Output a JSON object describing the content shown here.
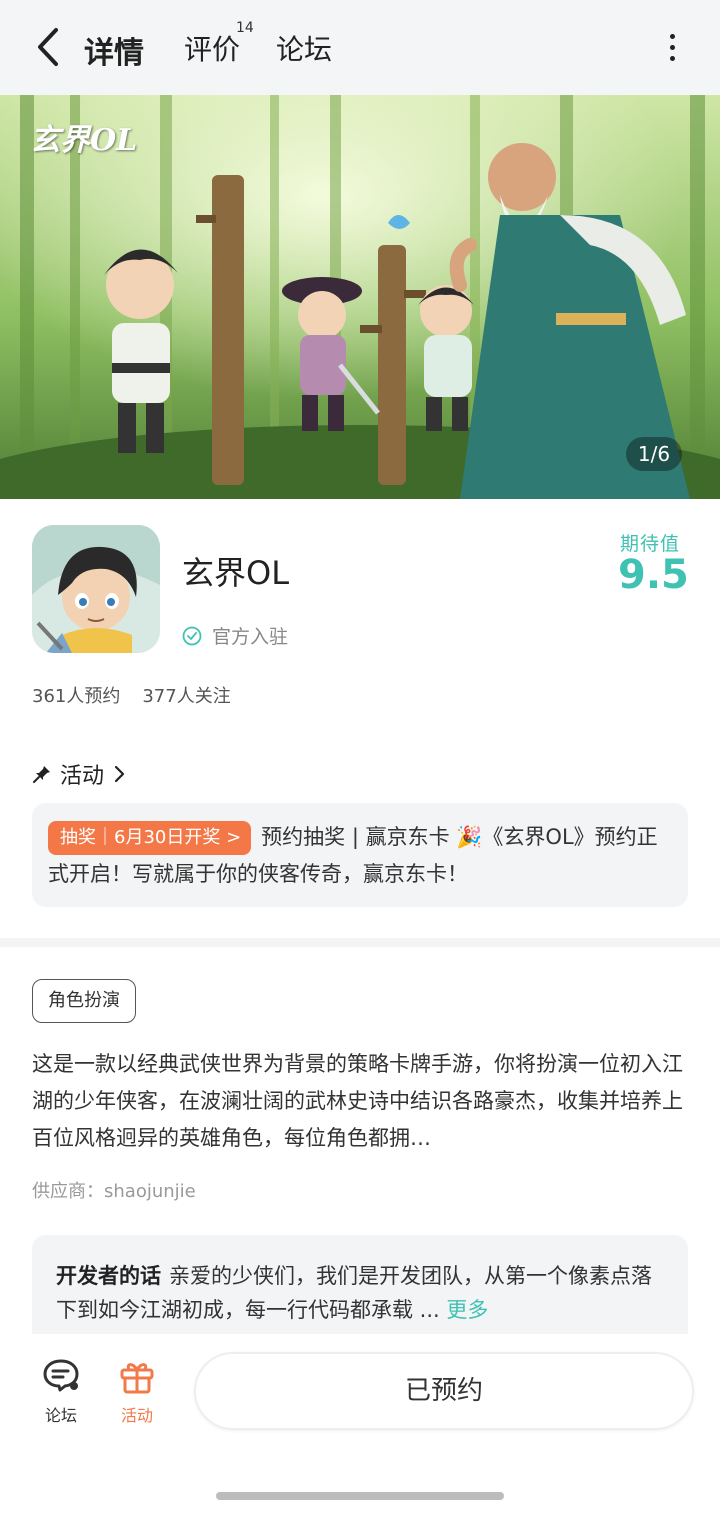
{
  "header": {
    "tabs": [
      {
        "label": "详情",
        "active": true
      },
      {
        "label": "评价",
        "badge": "14"
      },
      {
        "label": "论坛"
      }
    ]
  },
  "banner": {
    "logo_text": "玄界OL",
    "counter": "1/6"
  },
  "game": {
    "name": "玄界OL",
    "official_label": "官方入驻",
    "expect_label": "期待值",
    "expect_score": "9.5",
    "reservations": "361人预约",
    "followers": "377人关注"
  },
  "activity": {
    "title": "活动",
    "tag": "抽奖｜6月30日开奖 >",
    "text": "预约抽奖 | 赢京东卡 🎉《玄界OL》预约正式开启！写就属于你的侠客传奇，赢京东卡！"
  },
  "details": {
    "genre_tag": "角色扮演",
    "description": "这是一款以经典武侠世界为背景的策略卡牌手游，你将扮演一位初入江湖的少年侠客，在波澜壮阔的武林史诗中结识各路豪杰，收集并培养上百位风格迥异的英雄角色，每位角色都拥…",
    "supplier": "供应商：shaojunjie"
  },
  "developer": {
    "title": "开发者的话",
    "text": "亲爱的少侠们，我们是开发团队，从第一个像素点落下到如今江湖初成，每一行代码都承载 ...",
    "more": "更多"
  },
  "bottom_bar": {
    "forum_label": "论坛",
    "activity_label": "活动",
    "reserve_button": "已预约"
  },
  "colors": {
    "accent": "#3fc2b1",
    "activity_orange": "#f47747"
  }
}
